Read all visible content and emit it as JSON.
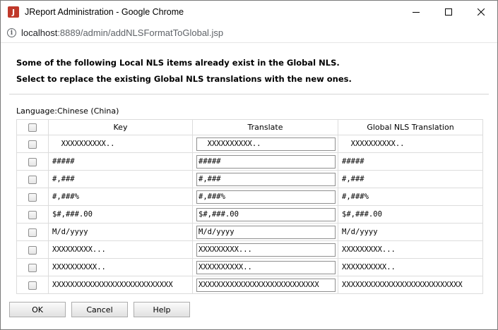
{
  "window": {
    "app_icon_letter": "J",
    "title": "JReport Administration - Google Chrome",
    "url_host": "localhost",
    "url_rest": ":8889/admin/addNLSFormatToGlobal.jsp"
  },
  "message": {
    "line1": "Some of the following Local NLS items already exist in the Global NLS.",
    "line2": "Select to replace the existing Global NLS translations with the new ones."
  },
  "language_label": "Language:Chinese (China)",
  "table": {
    "headers": {
      "key": "Key",
      "translate": "Translate",
      "global": "Global NLS Translation"
    },
    "rows": [
      {
        "key": "  XXXXXXXXXX..",
        "translate": "  XXXXXXXXXX..",
        "global": "  XXXXXXXXXX.."
      },
      {
        "key": "#####",
        "translate": "#####",
        "global": "#####"
      },
      {
        "key": "#,###",
        "translate": "#,###",
        "global": "#,###"
      },
      {
        "key": "#,###%",
        "translate": "#,###%",
        "global": "#,###%"
      },
      {
        "key": "$#,###.00",
        "translate": "$#,###.00",
        "global": "$#,###.00"
      },
      {
        "key": "M/d/yyyy",
        "translate": "M/d/yyyy",
        "global": "M/d/yyyy"
      },
      {
        "key": "XXXXXXXXX...",
        "translate": "XXXXXXXXX...",
        "global": "XXXXXXXXX..."
      },
      {
        "key": "XXXXXXXXXX..",
        "translate": "XXXXXXXXXX..",
        "global": "XXXXXXXXXX.."
      },
      {
        "key": "XXXXXXXXXXXXXXXXXXXXXXXXXXX",
        "translate": "XXXXXXXXXXXXXXXXXXXXXXXXXXX",
        "global": "XXXXXXXXXXXXXXXXXXXXXXXXXXX"
      }
    ]
  },
  "buttons": {
    "ok": "OK",
    "cancel": "Cancel",
    "help": "Help"
  }
}
